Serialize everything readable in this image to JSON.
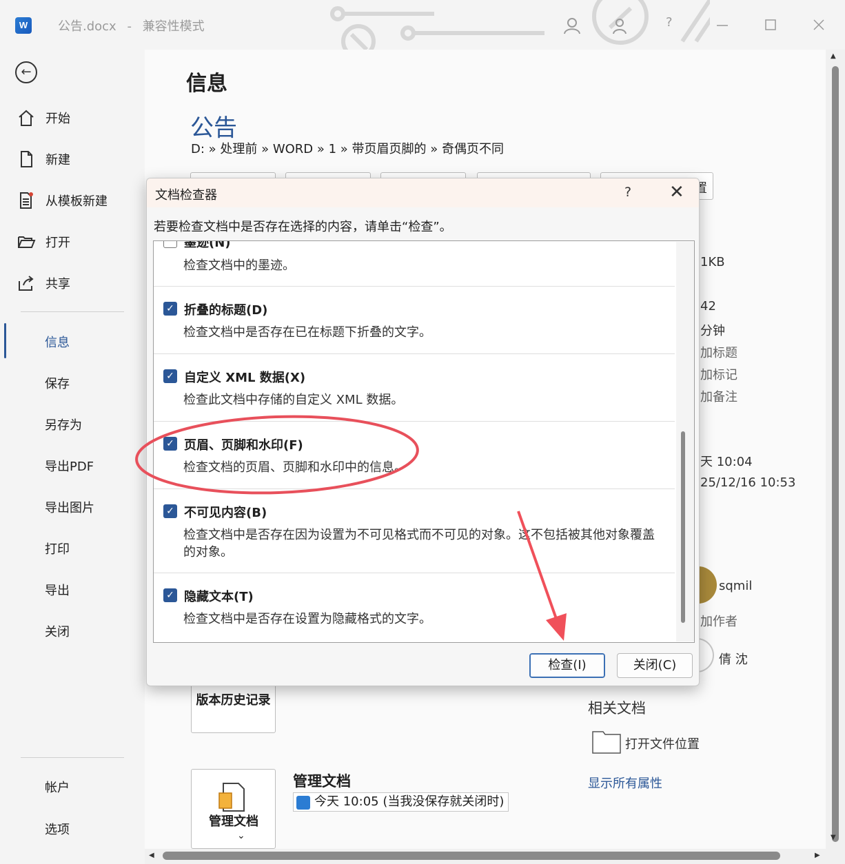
{
  "titlebar": {
    "app_icon": "word-icon",
    "logo_letter": "W",
    "doc_name": "公告.docx",
    "separator": "-",
    "mode": "兼容性模式",
    "help": "?"
  },
  "sidebar": {
    "top_items": [
      {
        "icon": "home-icon",
        "label": "开始"
      },
      {
        "icon": "new-doc-icon",
        "label": "新建"
      },
      {
        "icon": "template-icon",
        "label": "从模板新建"
      },
      {
        "icon": "folder-open-icon",
        "label": "打开"
      },
      {
        "icon": "share-icon",
        "label": "共享"
      }
    ],
    "mid_items": [
      "信息",
      "保存",
      "另存为",
      "导出PDF",
      "导出图片",
      "打印",
      "导出",
      "关闭"
    ],
    "bottom_items": [
      "帐户",
      "选项"
    ],
    "active": "信息"
  },
  "main": {
    "heading": "信息",
    "doc_title": "公告",
    "breadcrumb": "D: » 处理前 » WORD » 1 » 带页眉页脚的 » 奇偶页不同",
    "partial_button_text": "置",
    "right_props": [
      "1KB",
      "42",
      "分钟",
      "加标题",
      "加标记",
      "加备注",
      "天 10:04",
      "25/12/16 10:53"
    ],
    "author": "sqmil",
    "add_author": "加作者",
    "last_modified_by": "倩 沈",
    "related_docs_heading": "相关文档",
    "open_location": "打开文件位置",
    "show_all_props": "显示所有属性",
    "version_history": "版本历史记录",
    "manage_doc_heading": "管理文档",
    "manage_doc_tile": "管理文档",
    "autosave_item": "今天 10:05 (当我没保存就关闭时)"
  },
  "dialog": {
    "title": "文档检查器",
    "help": "?",
    "close_glyph": "✕",
    "hint": "若要检查文档中是否存在选择的内容，请单击“检查”。",
    "items": [
      {
        "title": "墨迹(N)",
        "desc": "检查文档中的墨迹。",
        "checked": false
      },
      {
        "title": "折叠的标题(D)",
        "desc": "检查文档中是否存在已在标题下折叠的文字。",
        "checked": true
      },
      {
        "title": "自定义 XML 数据(X)",
        "desc": "检查此文档中存储的自定义 XML 数据。",
        "checked": true
      },
      {
        "title": "页眉、页脚和水印(F)",
        "desc": "检查文档的页眉、页脚和水印中的信息。",
        "checked": true
      },
      {
        "title": "不可见内容(B)",
        "desc": "检查文档中是否存在因为设置为不可见格式而不可见的对象。这不包括被其他对象覆盖的对象。",
        "checked": true
      },
      {
        "title": "隐藏文本(T)",
        "desc": "检查文档中是否存在设置为隐藏格式的文字。",
        "checked": true
      }
    ],
    "inspect_button": "检查(I)",
    "close_button": "关闭(C)",
    "checkmark": "✓"
  },
  "annotation": {
    "ellipse_color": "#e8505b",
    "arrow_color": "#f0505a"
  }
}
